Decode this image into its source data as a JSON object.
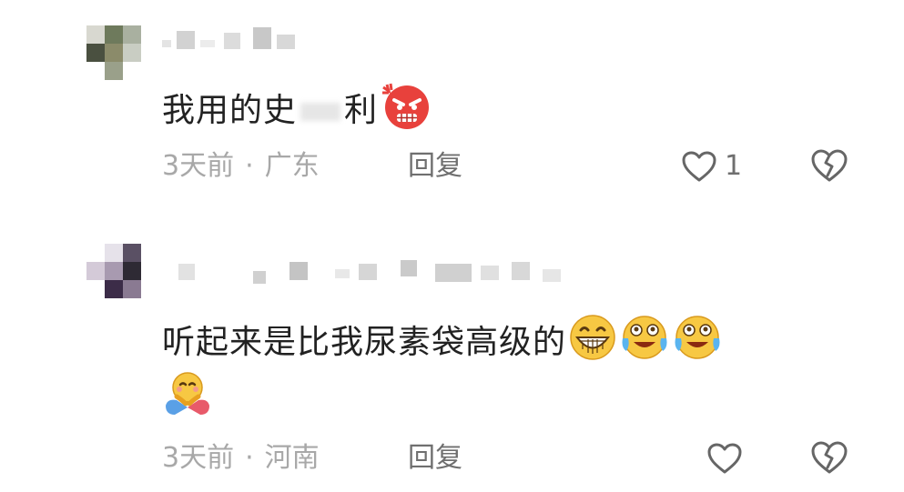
{
  "comments": [
    {
      "text_before": "我用的史",
      "text_after": "利",
      "emoji_icons": [
        "angry-face-icon"
      ],
      "time": "3天前",
      "separator": "·",
      "location": "广东",
      "reply_label": "回复",
      "like_count": "1"
    },
    {
      "text": "听起来是比我尿素袋高级的",
      "emoji_icons": [
        "grinning-face-icon",
        "laughing-crying-face-icon",
        "laughing-crying-face-icon",
        "hugging-face-icon"
      ],
      "time": "3天前",
      "separator": "·",
      "location": "河南",
      "reply_label": "回复",
      "like_count": ""
    }
  ],
  "colors": {
    "text": "#222222",
    "meta": "#a8a8a8",
    "action": "#6f6f6f",
    "icon_stroke": "#666666",
    "angry_red": "#e8413c",
    "emoji_yellow": "#f7c843",
    "tear_blue": "#5ab4ef"
  }
}
